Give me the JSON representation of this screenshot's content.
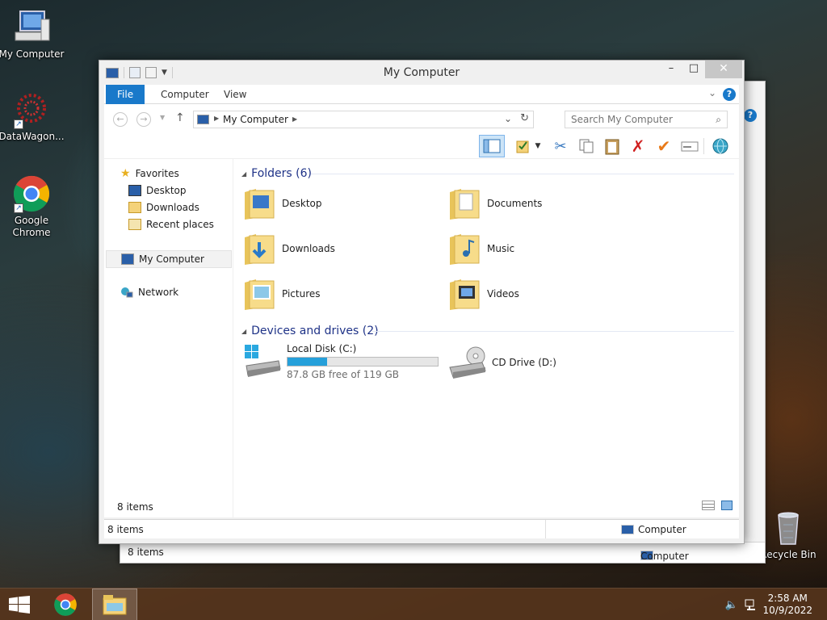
{
  "desktop": {
    "icons": [
      {
        "label": "My Computer"
      },
      {
        "label": "DataWagon..."
      },
      {
        "label": "Google Chrome"
      },
      {
        "label": "Recycle Bin"
      }
    ]
  },
  "back_window": {
    "status_items": "8 items",
    "status_location": "Computer"
  },
  "window": {
    "title": "My Computer",
    "tabs": [
      {
        "label": "File"
      },
      {
        "label": "Computer"
      },
      {
        "label": "View"
      }
    ],
    "help_label": "?",
    "address": {
      "path": "My Computer"
    },
    "search": {
      "placeholder": "Search My Computer"
    },
    "nav": {
      "favorites": "Favorites",
      "favorites_items": [
        "Desktop",
        "Downloads",
        "Recent places"
      ],
      "my_computer": "My Computer",
      "network": "Network"
    },
    "folders_header": "Folders (6)",
    "folders": [
      {
        "name": "Desktop"
      },
      {
        "name": "Documents"
      },
      {
        "name": "Downloads"
      },
      {
        "name": "Music"
      },
      {
        "name": "Pictures"
      },
      {
        "name": "Videos"
      }
    ],
    "devices_header": "Devices and drives (2)",
    "drives": [
      {
        "name": "Local Disk (C:)",
        "free_text": "87.8 GB free of 119 GB",
        "used_fraction": 0.262
      },
      {
        "name": "CD Drive (D:)"
      }
    ],
    "inner_status": "8 items",
    "status_items": "8 items",
    "status_location": "Computer"
  },
  "taskbar": {
    "time": "2:58 AM",
    "date": "10/9/2022"
  },
  "colors": {
    "accent": "#1979ca",
    "group_header": "#1e3287",
    "drive_fill": "#26a0da",
    "taskbar": "#58361c"
  }
}
